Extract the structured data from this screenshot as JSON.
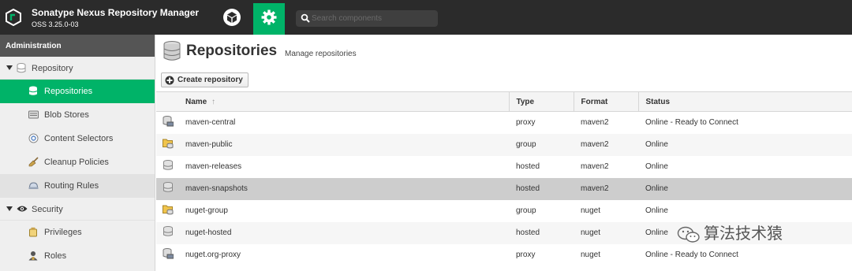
{
  "header": {
    "app_title": "Sonatype Nexus Repository Manager",
    "version": "OSS 3.25.0-03",
    "search_placeholder": "Search components",
    "icons": {
      "logo": "nexus-logo-icon",
      "browse": "cube-icon",
      "admin": "gear-icon",
      "search": "search-icon"
    },
    "accent": "#00b368"
  },
  "sidebar": {
    "header": "Administration",
    "groups": [
      {
        "label": "Repository",
        "icon": "database-icon",
        "expanded": true,
        "items": [
          {
            "label": "Repositories",
            "icon": "database-icon",
            "active": true
          },
          {
            "label": "Blob Stores",
            "icon": "hard-drive-icon"
          },
          {
            "label": "Content Selectors",
            "icon": "selector-icon"
          },
          {
            "label": "Cleanup Policies",
            "icon": "broom-icon"
          },
          {
            "label": "Routing Rules",
            "icon": "route-icon"
          }
        ]
      },
      {
        "label": "Security",
        "icon": "eye-icon",
        "expanded": true,
        "items": [
          {
            "label": "Privileges",
            "icon": "badge-icon"
          },
          {
            "label": "Roles",
            "icon": "user-roles-icon"
          }
        ]
      }
    ]
  },
  "main": {
    "title": "Repositories",
    "subtitle": "Manage repositories",
    "create_button": "Create repository",
    "columns": {
      "name": "Name",
      "sort_indicator": "↑",
      "type": "Type",
      "format": "Format",
      "status": "Status"
    },
    "rows": [
      {
        "icon": "proxy-repo-icon",
        "name": "maven-central",
        "type": "proxy",
        "format": "maven2",
        "status": "Online - Ready to Connect"
      },
      {
        "icon": "group-repo-icon",
        "name": "maven-public",
        "type": "group",
        "format": "maven2",
        "status": "Online"
      },
      {
        "icon": "hosted-repo-icon",
        "name": "maven-releases",
        "type": "hosted",
        "format": "maven2",
        "status": "Online"
      },
      {
        "icon": "hosted-repo-icon",
        "name": "maven-snapshots",
        "type": "hosted",
        "format": "maven2",
        "status": "Online",
        "selected": true
      },
      {
        "icon": "group-repo-icon",
        "name": "nuget-group",
        "type": "group",
        "format": "nuget",
        "status": "Online"
      },
      {
        "icon": "hosted-repo-icon",
        "name": "nuget-hosted",
        "type": "hosted",
        "format": "nuget",
        "status": "Online"
      },
      {
        "icon": "proxy-repo-icon",
        "name": "nuget.org-proxy",
        "type": "proxy",
        "format": "nuget",
        "status": "Online - Ready to Connect"
      }
    ]
  },
  "watermark": {
    "text": "算法技术猿",
    "icon": "wechat-icon"
  }
}
